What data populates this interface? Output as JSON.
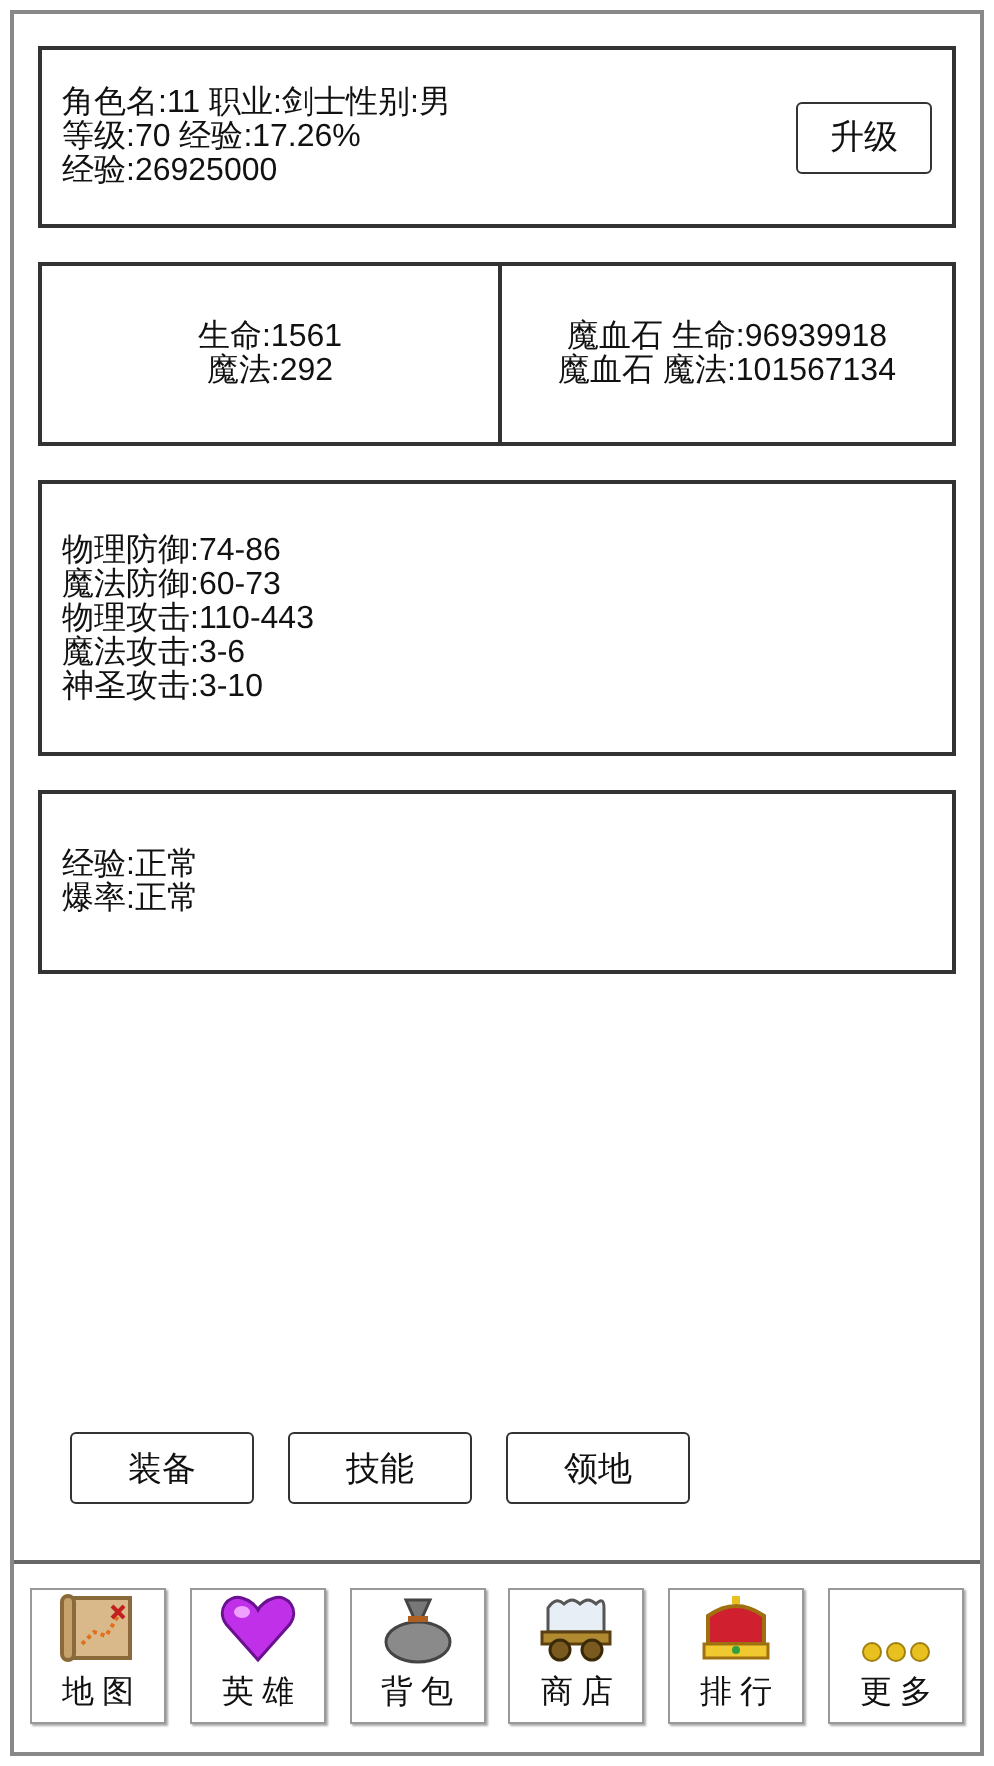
{
  "profile": {
    "lines": [
      "角色名:11  职业:剑士性别:男",
      "等级:70 经验:17.26%",
      "经验:26925000"
    ],
    "upgrade_button": "升级"
  },
  "vitals": {
    "base": [
      "生命:1561",
      "魔法:292"
    ],
    "stone": [
      "魔血石 生命:96939918",
      "魔血石 魔法:101567134"
    ]
  },
  "attributes": [
    "物理防御:74-86",
    "魔法防御:60-73",
    "物理攻击:110-443",
    "魔法攻击:3-6",
    "神圣攻击:3-10"
  ],
  "rates": [
    "经验:正常",
    "爆率:正常"
  ],
  "actions": [
    "装备",
    "技能",
    "领地"
  ],
  "nav": [
    {
      "kind": "map",
      "label": "地图"
    },
    {
      "kind": "heart",
      "label": "英雄"
    },
    {
      "kind": "bag",
      "label": "背包"
    },
    {
      "kind": "wagon",
      "label": "商店"
    },
    {
      "kind": "crown",
      "label": "排行"
    },
    {
      "kind": "more",
      "label": "更多"
    }
  ]
}
